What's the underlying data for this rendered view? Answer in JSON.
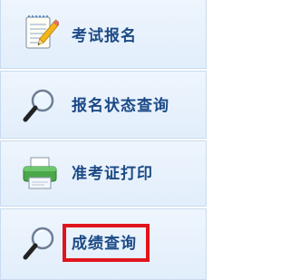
{
  "menu": {
    "items": [
      {
        "label": "考试报名",
        "icon": "notepad-pencil-icon"
      },
      {
        "label": "报名状态查询",
        "icon": "magnifier-icon"
      },
      {
        "label": "准考证打印",
        "icon": "printer-icon"
      },
      {
        "label": "成绩查询",
        "icon": "magnifier-icon",
        "highlighted": true
      }
    ]
  },
  "colors": {
    "label": "#1c4a86",
    "item_background": "#e8f1fc",
    "item_border": "#c9dbef",
    "highlight": "#e0141c"
  }
}
